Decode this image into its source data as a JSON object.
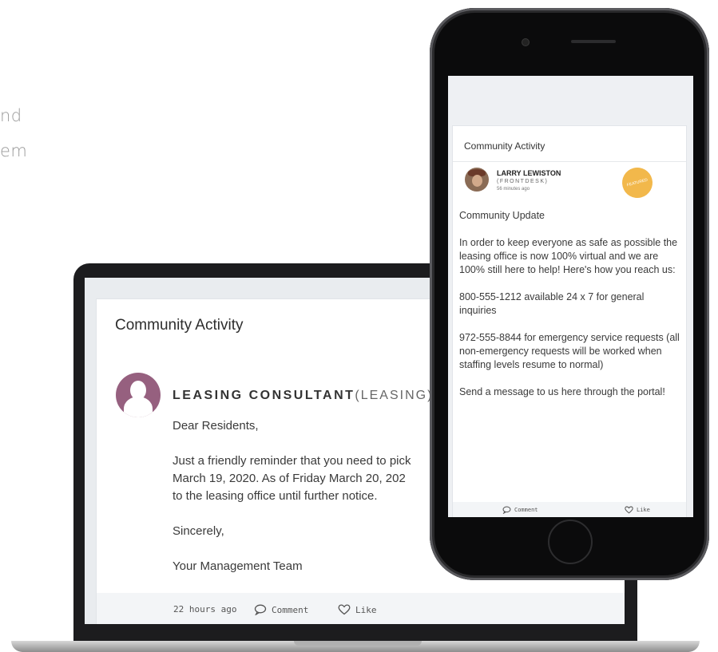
{
  "background_text": [
    "nd",
    "em"
  ],
  "laptop": {
    "card_title": "Community Activity",
    "author_name": "LEASING CONSULTANT",
    "author_role": "(LEASING)",
    "post_lines": [
      "Dear Residents,",
      "Just a friendly reminder that you need to pick",
      "March 19, 2020. As of Friday March 20, 202",
      "to the leasing office until further notice.",
      "Sincerely,",
      "Your Management Team"
    ],
    "timestamp": "22 hours ago",
    "comment_label": "Comment",
    "like_label": "Like"
  },
  "phone": {
    "card_title": "Community Activity",
    "author_name": "LARRY LEWISTON",
    "author_role": "(FRONTDESK)",
    "timestamp": "56 minutes ago",
    "badge_label": "FEATURED",
    "post_paragraphs": [
      "Community Update",
      "In order to keep everyone as safe as possible the leasing office is now 100% virtual and we are 100% still here to help! Here's how you reach us:",
      "800-555-1212 available 24 x 7 for general inquiries",
      "972-555-8844 for emergency service requests (all non-emergency requests will be worked when staffing levels resume to normal)",
      "Send a message to us here through the portal!"
    ],
    "comment_label": "Comment",
    "like_label": "Like"
  },
  "colors": {
    "avatar_purple": "#96607f",
    "badge_gold": "#f2b84b"
  }
}
